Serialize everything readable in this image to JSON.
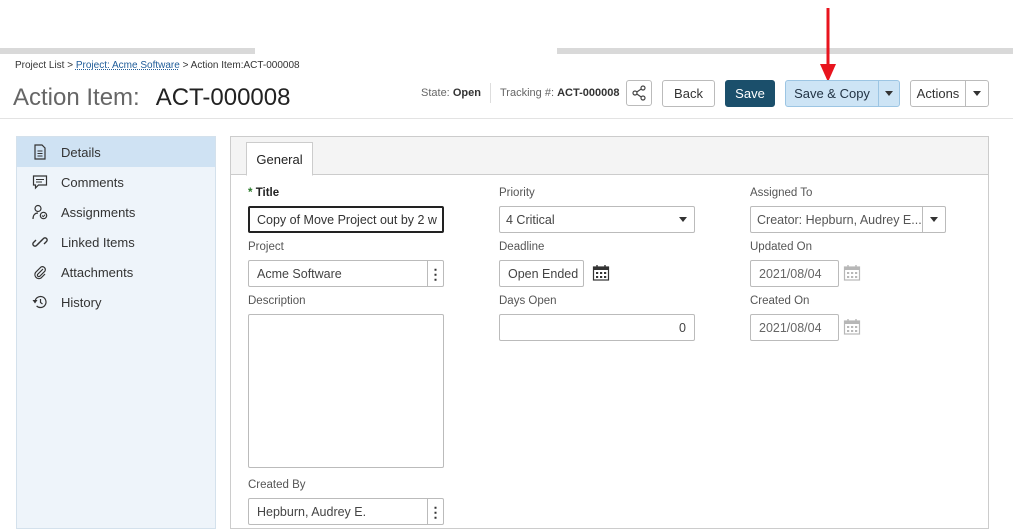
{
  "breadcrumb": {
    "root": "Project List",
    "sep1": ">",
    "project": "Project: Acme Software",
    "sep2": ">",
    "current": "Action Item:ACT-000008"
  },
  "title": {
    "label": "Action Item:",
    "id": "ACT-000008"
  },
  "header": {
    "state_label": "State:",
    "state_value": "Open",
    "tracking_label": "Tracking #:",
    "tracking_value": "ACT-000008",
    "share_icon": "share-icon",
    "back_label": "Back",
    "save_label": "Save",
    "save_copy_label": "Save & Copy",
    "actions_label": "Actions"
  },
  "sidebar": {
    "items": [
      {
        "label": "Details",
        "icon": "document-icon",
        "active": true
      },
      {
        "label": "Comments",
        "icon": "comment-icon"
      },
      {
        "label": "Assignments",
        "icon": "assignment-icon"
      },
      {
        "label": "Linked Items",
        "icon": "link-icon"
      },
      {
        "label": "Attachments",
        "icon": "paperclip-icon"
      },
      {
        "label": "History",
        "icon": "history-icon"
      }
    ]
  },
  "tabs": [
    {
      "label": "General",
      "active": true
    }
  ],
  "form": {
    "title": {
      "label": "Title",
      "required_mark": "*",
      "value": "Copy of Move Project out by 2 w"
    },
    "priority": {
      "label": "Priority",
      "value": "4 Critical"
    },
    "assigned_to": {
      "label": "Assigned To",
      "value": "Creator: Hepburn, Audrey E...."
    },
    "project": {
      "label": "Project",
      "value": "Acme Software"
    },
    "deadline": {
      "label": "Deadline",
      "value": "Open Ended"
    },
    "updated_on": {
      "label": "Updated On",
      "value": "2021/08/04"
    },
    "description": {
      "label": "Description",
      "value": ""
    },
    "days_open": {
      "label": "Days Open",
      "value": "0"
    },
    "created_on": {
      "label": "Created On",
      "value": "2021/08/04"
    },
    "created_by": {
      "label": "Created By",
      "value": "Hepburn, Audrey E."
    }
  },
  "colors": {
    "save_bg": "#1b4f6b",
    "save_copy_bg": "#cde4f5",
    "annotation_arrow": "#e8141e",
    "sidebar_bg": "#eef4fa",
    "sidebar_active": "#cfe2f3"
  }
}
